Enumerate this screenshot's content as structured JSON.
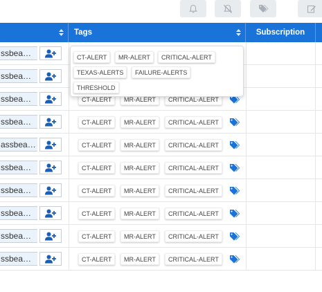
{
  "toolbar": {
    "buttons": [
      {
        "icon": "bell-icon"
      },
      {
        "icon": "bell-slash-icon"
      },
      {
        "icon": "tags-icon"
      },
      {
        "icon": "edit-icon"
      }
    ]
  },
  "table": {
    "headers": {
      "tags": "Tags",
      "subscription": "Subscription"
    },
    "rows": [
      {
        "user": "ssbea…",
        "tags": [
          "CT-ALERT",
          "MR-ALERT",
          "CRITICAL-ALERT"
        ]
      },
      {
        "user": "ssbea…",
        "tags": [
          "CT-ALERT",
          "MR-ALERT",
          "CRITICAL-ALERT"
        ]
      },
      {
        "user": "ssbea…",
        "tags": [
          "CT-ALERT",
          "MR-ALERT",
          "CRITICAL-ALERT"
        ]
      },
      {
        "user": "ssbea…",
        "tags": [
          "CT-ALERT",
          "MR-ALERT",
          "CRITICAL-ALERT"
        ]
      },
      {
        "user": "assbea…",
        "tags": [
          "CT-ALERT",
          "MR-ALERT",
          "CRITICAL-ALERT"
        ]
      },
      {
        "user": "ssbea…",
        "tags": [
          "CT-ALERT",
          "MR-ALERT",
          "CRITICAL-ALERT"
        ]
      },
      {
        "user": "ssbea…",
        "tags": [
          "CT-ALERT",
          "MR-ALERT",
          "CRITICAL-ALERT"
        ]
      },
      {
        "user": "ssbea…",
        "tags": [
          "CT-ALERT",
          "MR-ALERT",
          "CRITICAL-ALERT"
        ]
      },
      {
        "user": "ssbea…",
        "tags": [
          "CT-ALERT",
          "MR-ALERT",
          "CRITICAL-ALERT"
        ]
      },
      {
        "user": "ssbea…",
        "tags": [
          "CT-ALERT",
          "MR-ALERT",
          "CRITICAL-ALERT"
        ]
      }
    ]
  },
  "popover": {
    "tags": [
      "CT-ALERT",
      "MR-ALERT",
      "CRITICAL-ALERT",
      "TEXAS-ALERTS",
      "FAILURE-ALERTS",
      "THRESHOLD"
    ]
  },
  "colors": {
    "header_bg": "#1a73d9",
    "icon_blue": "#1a73d9",
    "toolbar_btn_bg": "#e9ecef"
  }
}
